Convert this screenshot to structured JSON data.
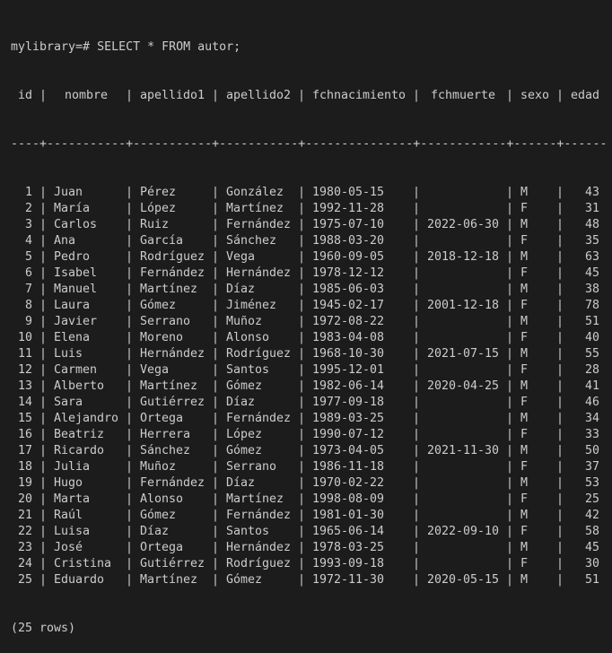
{
  "prompt": "mylibrary=# SELECT * FROM autor;",
  "columns": [
    {
      "key": "id",
      "label": "id",
      "width": 2,
      "align": "r"
    },
    {
      "key": "nombre",
      "label": "nombre",
      "width": 9,
      "align": "l"
    },
    {
      "key": "apellido1",
      "label": "apellido1",
      "width": 9,
      "align": "l"
    },
    {
      "key": "apellido2",
      "label": "apellido2",
      "width": 9,
      "align": "l"
    },
    {
      "key": "fchnacimiento",
      "label": "fchnacimiento",
      "width": 13,
      "align": "l"
    },
    {
      "key": "fchmuerte",
      "label": "fchmuerte",
      "width": 10,
      "align": "l"
    },
    {
      "key": "sexo",
      "label": "sexo",
      "width": 4,
      "align": "l"
    },
    {
      "key": "edad",
      "label": "edad",
      "width": 4,
      "align": "r"
    }
  ],
  "separator_line": "----+-----------+-----------+-----------+---------------+------------+------+------",
  "rows": [
    [
      "1",
      "Juan",
      "Pérez",
      "González",
      "1980-05-15",
      "",
      "M",
      "43"
    ],
    [
      "2",
      "María",
      "López",
      "Martínez",
      "1992-11-28",
      "",
      "F",
      "31"
    ],
    [
      "3",
      "Carlos",
      "Ruiz",
      "Fernández",
      "1975-07-10",
      "2022-06-30",
      "M",
      "48"
    ],
    [
      "4",
      "Ana",
      "García",
      "Sánchez",
      "1988-03-20",
      "",
      "F",
      "35"
    ],
    [
      "5",
      "Pedro",
      "Rodríguez",
      "Vega",
      "1960-09-05",
      "2018-12-18",
      "M",
      "63"
    ],
    [
      "6",
      "Isabel",
      "Fernández",
      "Hernández",
      "1978-12-12",
      "",
      "F",
      "45"
    ],
    [
      "7",
      "Manuel",
      "Martínez",
      "Díaz",
      "1985-06-03",
      "",
      "M",
      "38"
    ],
    [
      "8",
      "Laura",
      "Gómez",
      "Jiménez",
      "1945-02-17",
      "2001-12-18",
      "F",
      "78"
    ],
    [
      "9",
      "Javier",
      "Serrano",
      "Muñoz",
      "1972-08-22",
      "",
      "M",
      "51"
    ],
    [
      "10",
      "Elena",
      "Moreno",
      "Alonso",
      "1983-04-08",
      "",
      "F",
      "40"
    ],
    [
      "11",
      "Luis",
      "Hernández",
      "Rodríguez",
      "1968-10-30",
      "2021-07-15",
      "M",
      "55"
    ],
    [
      "12",
      "Carmen",
      "Vega",
      "Santos",
      "1995-12-01",
      "",
      "F",
      "28"
    ],
    [
      "13",
      "Alberto",
      "Martínez",
      "Gómez",
      "1982-06-14",
      "2020-04-25",
      "M",
      "41"
    ],
    [
      "14",
      "Sara",
      "Gutiérrez",
      "Díaz",
      "1977-09-18",
      "",
      "F",
      "46"
    ],
    [
      "15",
      "Alejandro",
      "Ortega",
      "Fernández",
      "1989-03-25",
      "",
      "M",
      "34"
    ],
    [
      "16",
      "Beatriz",
      "Herrera",
      "López",
      "1990-07-12",
      "",
      "F",
      "33"
    ],
    [
      "17",
      "Ricardo",
      "Sánchez",
      "Gómez",
      "1973-04-05",
      "2021-11-30",
      "M",
      "50"
    ],
    [
      "18",
      "Julia",
      "Muñoz",
      "Serrano",
      "1986-11-18",
      "",
      "F",
      "37"
    ],
    [
      "19",
      "Hugo",
      "Fernández",
      "Díaz",
      "1970-02-22",
      "",
      "M",
      "53"
    ],
    [
      "20",
      "Marta",
      "Alonso",
      "Martínez",
      "1998-08-09",
      "",
      "F",
      "25"
    ],
    [
      "21",
      "Raúl",
      "Gómez",
      "Fernández",
      "1981-01-30",
      "",
      "M",
      "42"
    ],
    [
      "22",
      "Luisa",
      "Díaz",
      "Santos",
      "1965-06-14",
      "2022-09-10",
      "F",
      "58"
    ],
    [
      "23",
      "José",
      "Ortega",
      "Hernández",
      "1978-03-25",
      "",
      "M",
      "45"
    ],
    [
      "24",
      "Cristina",
      "Gutiérrez",
      "Rodríguez",
      "1993-09-18",
      "",
      "F",
      "30"
    ],
    [
      "25",
      "Eduardo",
      "Martínez",
      "Gómez",
      "1972-11-30",
      "2020-05-15",
      "M",
      "51"
    ]
  ],
  "footer": "(25 rows)",
  "colors": {
    "background": "#1c1c1c",
    "text": "#cccccc"
  }
}
